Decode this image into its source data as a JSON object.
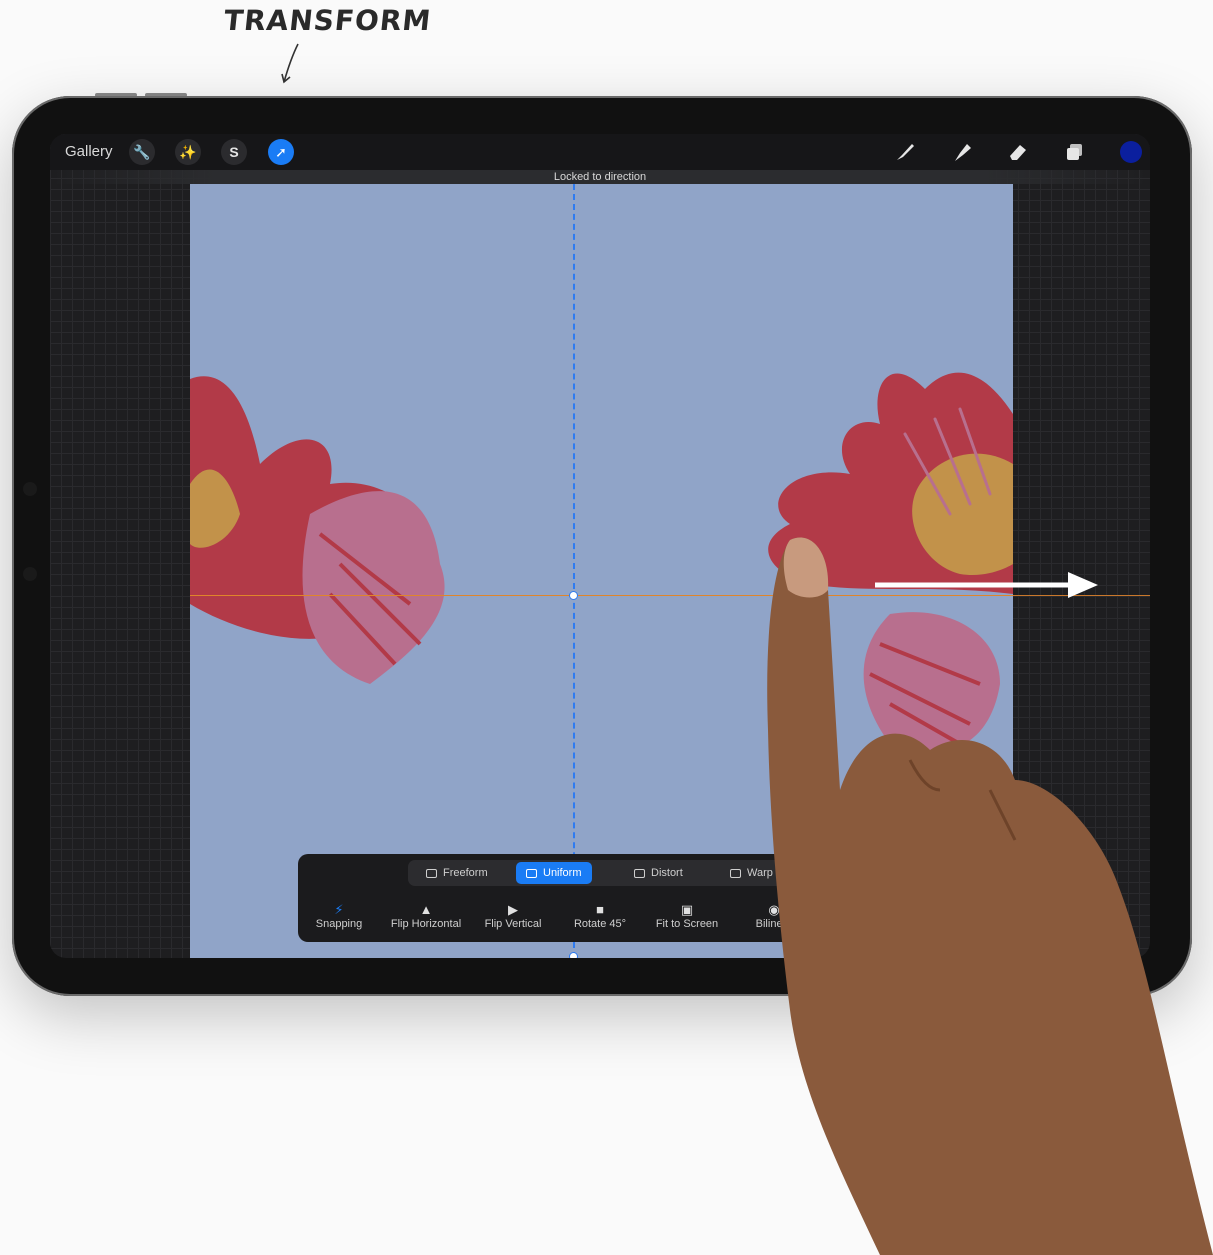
{
  "annotation": {
    "label": "TRANSFORM"
  },
  "toolbar": {
    "gallery_label": "Gallery",
    "left_icons": [
      "wrench-icon",
      "magic-wand-icon",
      "selection-s-icon",
      "transform-arrow-icon"
    ],
    "right_icons": [
      "brush-icon",
      "smudge-icon",
      "eraser-icon",
      "layers-icon"
    ],
    "current_color": "#0b1f9e"
  },
  "status": {
    "message": "Locked to direction"
  },
  "transform_panel": {
    "modes": [
      {
        "label": "Freeform",
        "active": false
      },
      {
        "label": "Uniform",
        "active": true
      },
      {
        "label": "Distort",
        "active": false
      },
      {
        "label": "Warp",
        "active": false
      }
    ],
    "actions": [
      {
        "label": "Snapping",
        "active": true
      },
      {
        "label": "Flip Horizontal",
        "active": false
      },
      {
        "label": "Flip Vertical",
        "active": false
      },
      {
        "label": "Rotate 45°",
        "active": false
      },
      {
        "label": "Fit to Screen",
        "active": false
      },
      {
        "label": "Bilinear",
        "active": false
      }
    ]
  },
  "colors": {
    "accent": "#1a7cf5",
    "canvas": "#90a4c8",
    "petal": "#b23a48",
    "leaf": "#b86f8e",
    "center": "#c2924a"
  }
}
